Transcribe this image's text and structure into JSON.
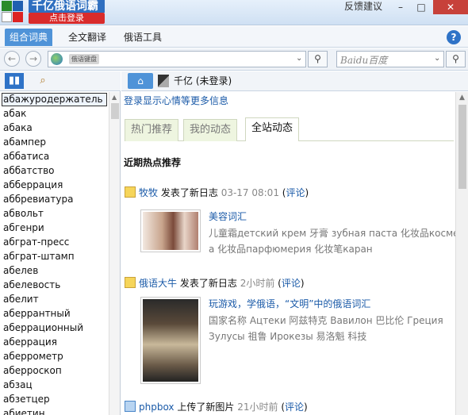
{
  "window": {
    "title": "千亿俄语词霸",
    "login_button": "点击登录",
    "feedback": "反馈建议",
    "min": "–",
    "max": "□",
    "close": "✕"
  },
  "menu": {
    "items": [
      "组合词典",
      "全文翻译",
      "俄语工具"
    ],
    "help": "?"
  },
  "addressbar": {
    "back": "←",
    "forward": "→",
    "tag": "俄语键盘",
    "dropdown": "⌄",
    "search_icon": "⚲",
    "engine": "Baidu百度"
  },
  "left": {
    "tab_book": "▮▮",
    "tab_find": "⌕",
    "words": [
      "абажуродержатель",
      "абак",
      "абака",
      "абампер",
      "аббатиса",
      "аббатство",
      "абберрация",
      "аббревиатура",
      "абвольт",
      "абгенри",
      "абграт-пресс",
      "абграт-штамп",
      "абелев",
      "абелевость",
      "абелит",
      "аберрантный",
      "аберрационный",
      "аберрация",
      "аберрометр",
      "аберроскоп",
      "абзац",
      "абзетцер",
      "абиетин"
    ]
  },
  "right": {
    "home": "⌂",
    "username": "千亿 (未登录)",
    "login_hint": "登录显示心情等更多信息",
    "tabs": [
      "热门推荐",
      "我的动态",
      "全站动态"
    ],
    "section_title": "近期热点推荐",
    "feed": [
      {
        "user": "牧牧",
        "action": "发表了新日志",
        "time": "03-17 08:01",
        "comment": "评论",
        "title": "美容词汇",
        "lines": [
          "儿童霜детский крем 牙膏 зубная паста 化妆品косметик",
          "а 化妆品парфюмерия 化妆笔каран"
        ]
      },
      {
        "user": "俄语大牛",
        "action": "发表了新日志",
        "time": "2小时前",
        "comment": "评论",
        "title": "玩游戏，学俄语，“文明”中的俄语词汇",
        "lines": [
          "国家名称 Ацтеки 阿兹特克 Вавилон 巴比伦 Греция",
          "Зулусы 祖鲁 Ирокезы 易洛魁 科技"
        ]
      },
      {
        "user": "phpbox",
        "action": "上传了新图片",
        "time": "21小时前",
        "comment": "评论"
      }
    ]
  },
  "colors": {
    "accent": "#4f93d8",
    "link": "#1a5aa8",
    "close_red": "#c7413a"
  }
}
